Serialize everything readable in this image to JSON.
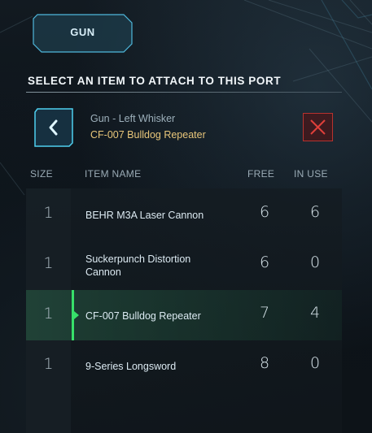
{
  "tab": {
    "label": "GUN"
  },
  "heading": "SELECT AN ITEM TO ATTACH TO THIS PORT",
  "port": {
    "label": "Gun - Left Whisker",
    "current_item": "CF-007 Bulldog Repeater"
  },
  "columns": {
    "size": "SIZE",
    "item_name": "ITEM NAME",
    "free": "FREE",
    "in_use": "IN USE"
  },
  "rows": [
    {
      "size": "1",
      "name": "BEHR M3A Laser Cannon",
      "free": "6",
      "in_use": "6",
      "selected": false
    },
    {
      "size": "1",
      "name": "Suckerpunch Distortion Cannon",
      "free": "6",
      "in_use": "0",
      "selected": false
    },
    {
      "size": "1",
      "name": "CF-007 Bulldog Repeater",
      "free": "7",
      "in_use": "4",
      "selected": true
    },
    {
      "size": "1",
      "name": "9-Series Longsword",
      "free": "8",
      "in_use": "0",
      "selected": false
    }
  ],
  "icons": {
    "back": "chevron-left-icon",
    "remove": "close-icon"
  },
  "colors": {
    "accent_cyan": "#4fd0f0",
    "selected_green": "#37e06a",
    "current_item_gold": "#e8c67a",
    "remove_red": "#b8322e"
  }
}
